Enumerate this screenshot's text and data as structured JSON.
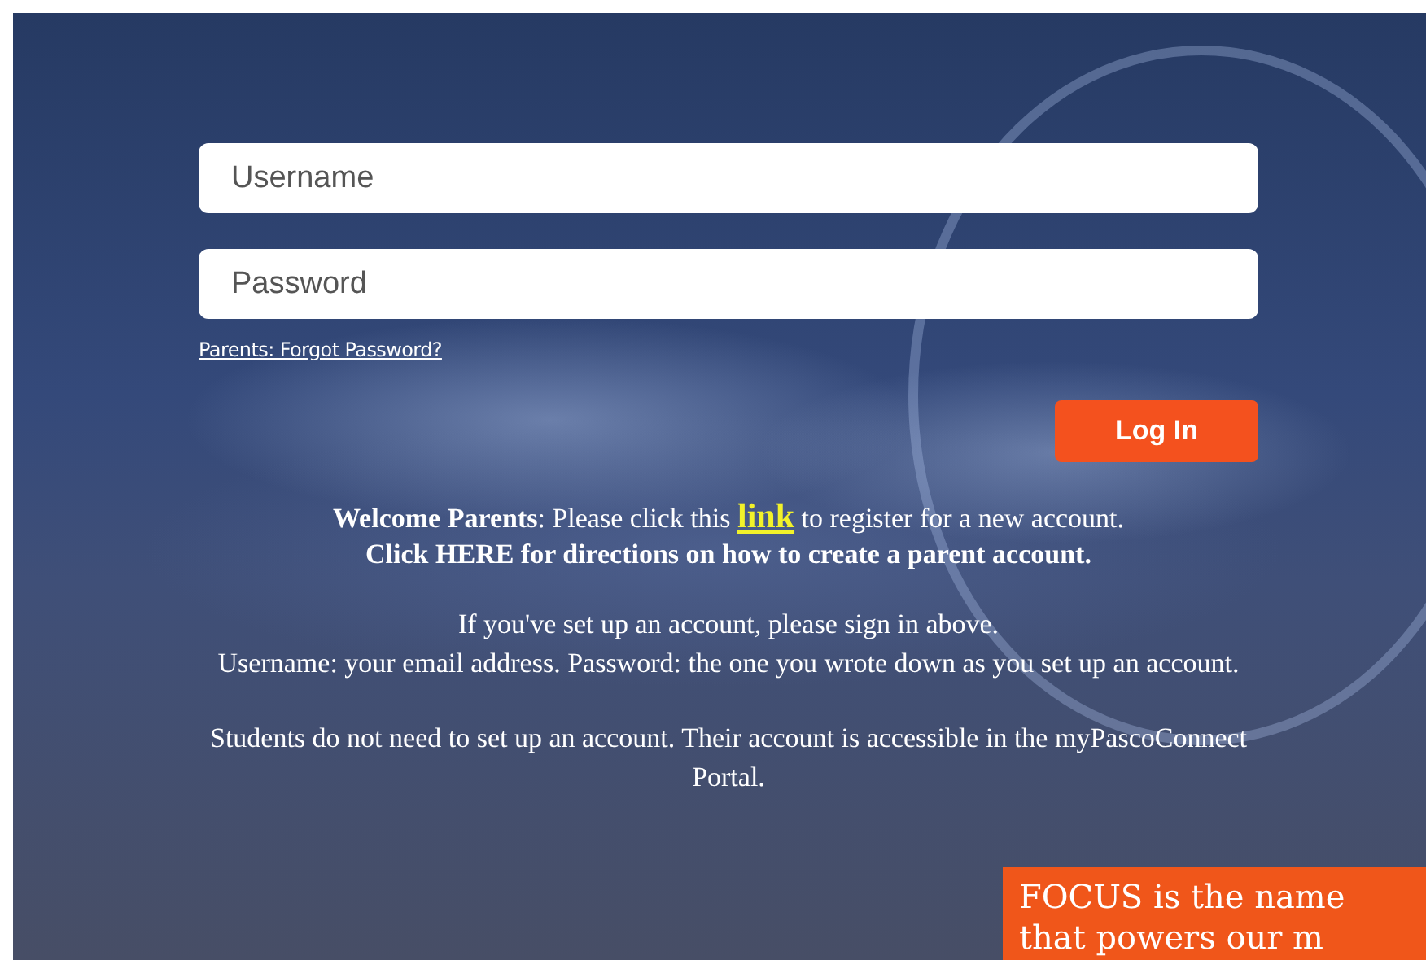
{
  "login_form": {
    "username": {
      "placeholder": "Username"
    },
    "password": {
      "placeholder": "Password"
    },
    "forgot_link": "Parents: Forgot Password?",
    "login_button": "Log In"
  },
  "welcome": {
    "intro": "**Welcome Parents**: Please click this",
    "link": "link",
    "outro": "to register for a new account.",
    "directions_link": "Click HERE for directions on how to create a parent account."
  },
  "info_paragraphs": [
    "If you've set up an account, please sign in above.\nUsername: your email address. Password: the one you wrote down as you set up an account.",
    "Students do not need to set up an account. Their account is accessible in the myPascoConnect Portal."
  ],
  "callout": {
    "lines": [
      "FOCUS is the name",
      "that powers our m"
    ]
  }
}
